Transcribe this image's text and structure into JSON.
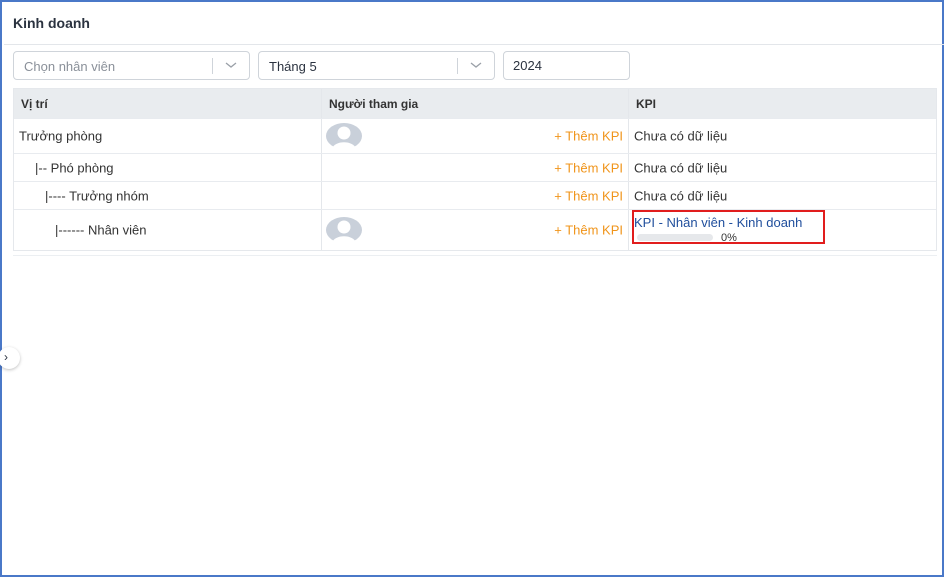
{
  "header": {
    "title": "Kinh doanh"
  },
  "filters": {
    "employee_placeholder": "Chọn nhân viên",
    "month_value": "Tháng 5",
    "year_value": "2024"
  },
  "table": {
    "columns": [
      "Vị trí",
      "Người tham gia",
      "KPI"
    ],
    "rows": [
      {
        "position": "Trưởng phòng",
        "has_avatar": true,
        "add_kpi": "+ Thêm KPI",
        "kpi": "Chưa có dữ liệu"
      },
      {
        "position": "|-- Phó phòng",
        "has_avatar": false,
        "add_kpi": "+ Thêm KPI",
        "kpi": "Chưa có dữ liệu"
      },
      {
        "position": "|---- Trưởng nhóm",
        "has_avatar": false,
        "add_kpi": "+ Thêm KPI",
        "kpi": "Chưa có dữ liệu"
      },
      {
        "position": "|------ Nhân viên",
        "has_avatar": true,
        "add_kpi": "+ Thêm KPI",
        "kpi_link": "KPI - Nhân viên - Kinh doanh",
        "progress_text": "0%",
        "progress_fraction": 0
      }
    ]
  },
  "colors": {
    "accent_orange": "#f0941a",
    "link_blue": "#1f4e9c",
    "highlight_red": "#e11d1d",
    "header_bg": "#e9ecef"
  },
  "icons": {
    "chevron": "chevron-down-icon",
    "avatar": "user-avatar-icon",
    "sidebar_toggle": "chevron-right-icon"
  }
}
